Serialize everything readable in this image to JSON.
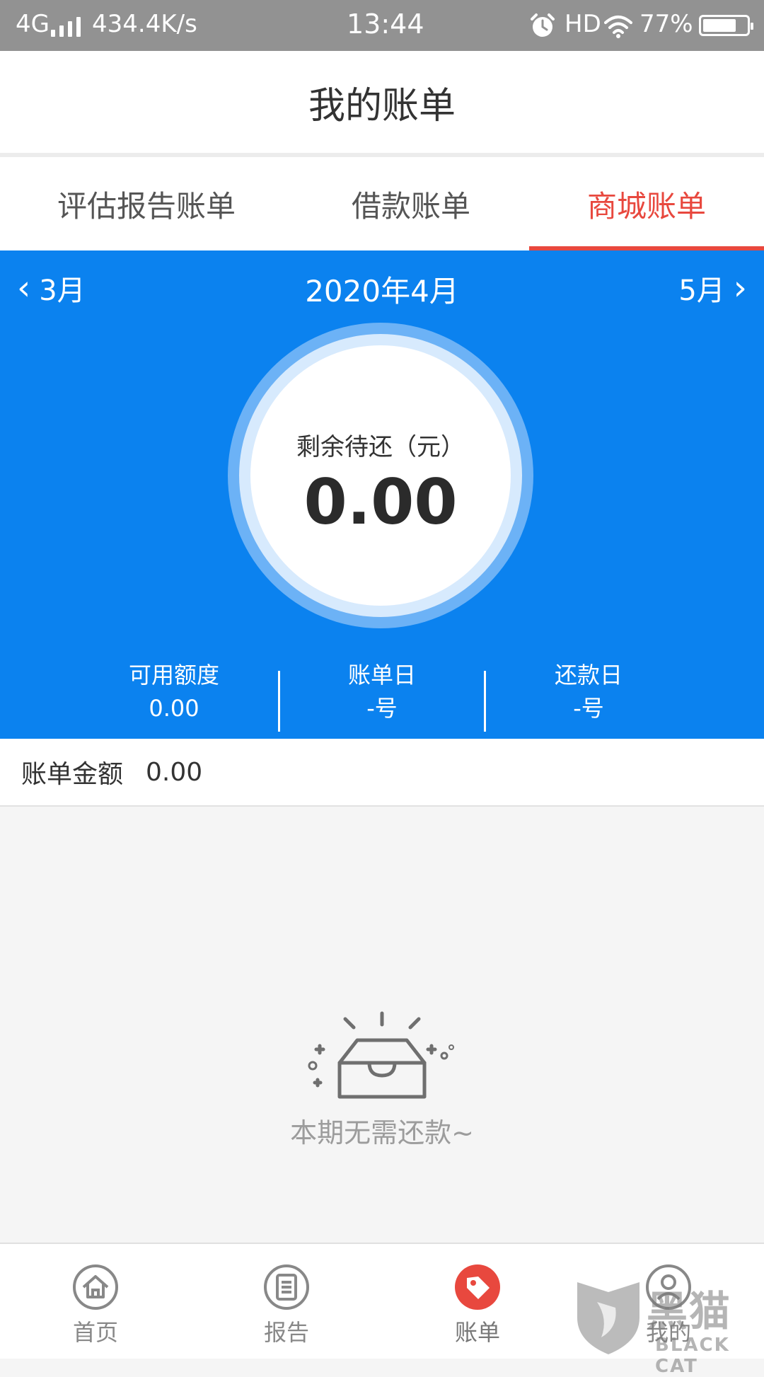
{
  "status_bar": {
    "network": "4G",
    "speed": "434.4K/s",
    "time": "13:44",
    "hd": "HD",
    "battery": "77%",
    "battery_level": 0.77,
    "icons": [
      "signal-icon",
      "alarm-icon",
      "wifi-icon",
      "battery-icon"
    ]
  },
  "header": {
    "title": "我的账单"
  },
  "tabs": [
    {
      "label": "评估报告账单",
      "active": false
    },
    {
      "label": "借款账单",
      "active": false
    },
    {
      "label": "商城账单",
      "active": true
    }
  ],
  "month_nav": {
    "prev": "3月",
    "current": "2020年4月",
    "next": "5月"
  },
  "summary": {
    "remaining_label": "剩余待还（元）",
    "remaining_value": "0.00"
  },
  "stats": [
    {
      "label": "可用额度",
      "value": "0.00"
    },
    {
      "label": "账单日",
      "value": "-号"
    },
    {
      "label": "还款日",
      "value": "-号"
    }
  ],
  "bill": {
    "label": "账单金额",
    "value": "0.00"
  },
  "empty_state": {
    "icon": "empty-box-icon",
    "message": "本期无需还款~"
  },
  "tabbar": [
    {
      "label": "首页",
      "icon": "home-icon"
    },
    {
      "label": "报告",
      "icon": "report-icon"
    },
    {
      "label": "账单",
      "icon": "bill-tag-icon",
      "active": true
    },
    {
      "label": "我的",
      "icon": "profile-icon"
    }
  ],
  "watermark": {
    "text": "黑猫",
    "subtext": "BLACK CAT"
  },
  "colors": {
    "primary_blue": "#0b82ef",
    "accent_red": "#e8483e",
    "status_gray": "#929292"
  }
}
